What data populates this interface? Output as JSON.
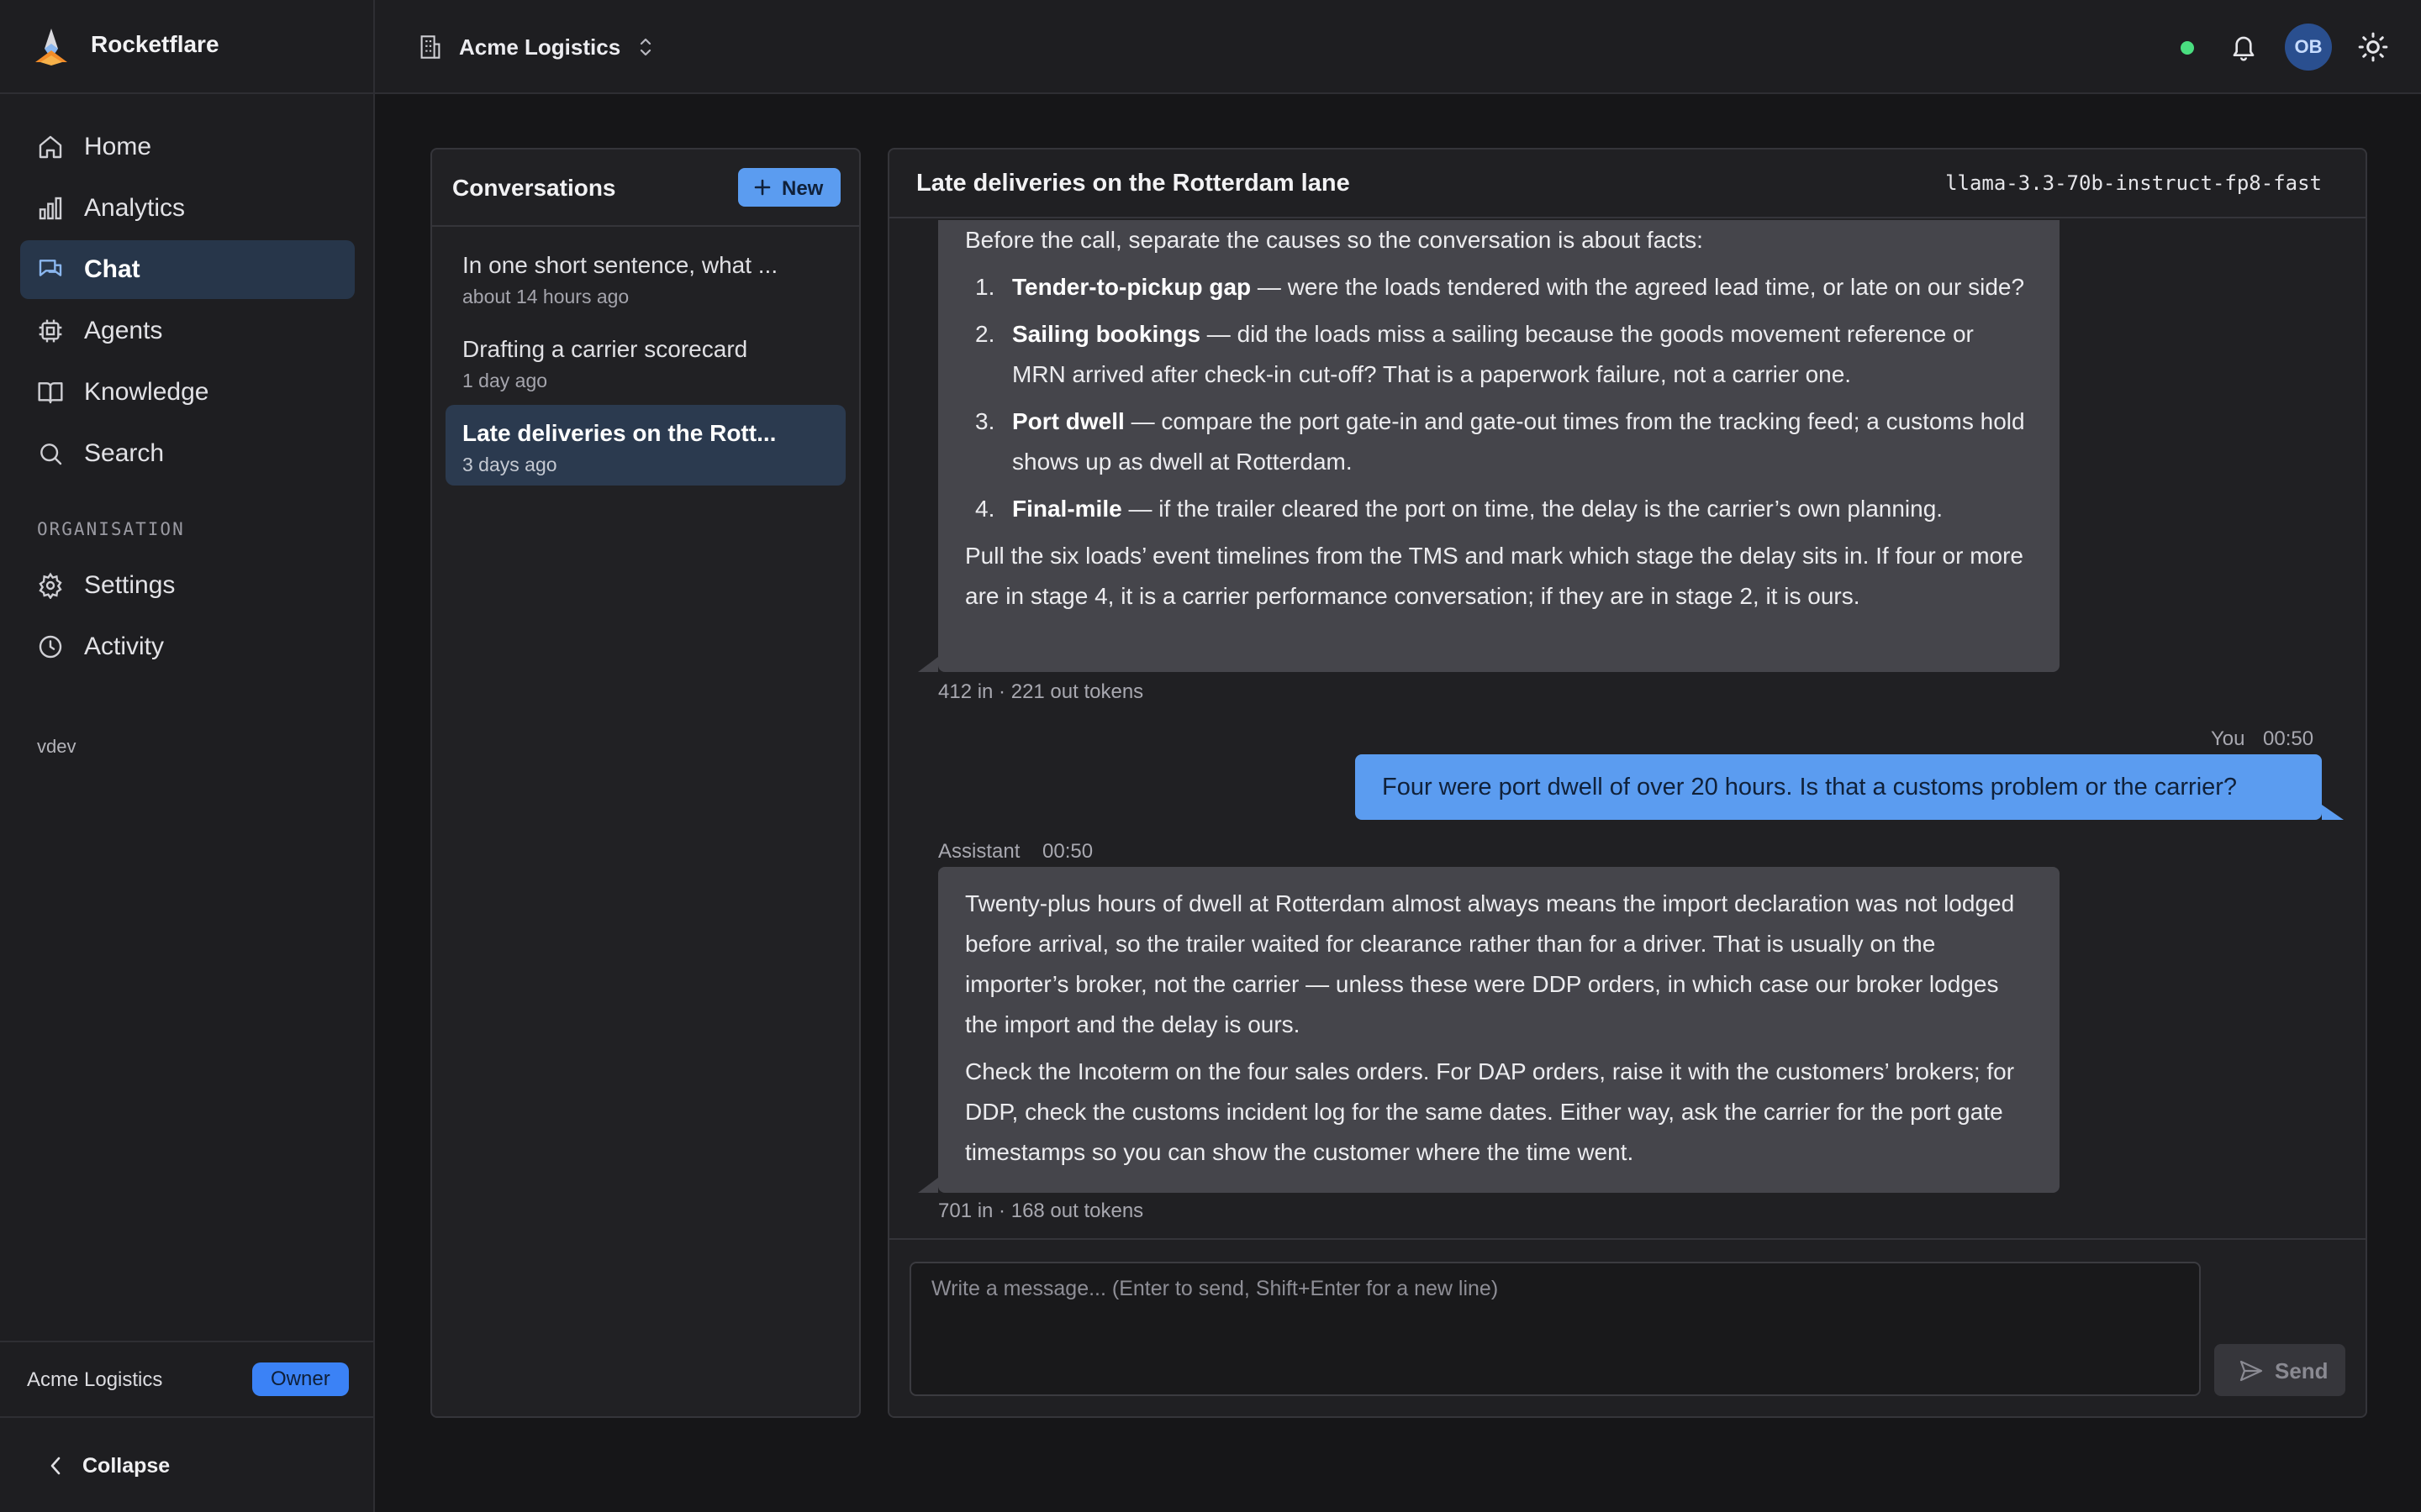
{
  "app": {
    "name": "Rocketflare",
    "version": "vdev"
  },
  "sidebar": {
    "items": [
      {
        "label": "Home",
        "icon": "home-icon"
      },
      {
        "label": "Analytics",
        "icon": "bar-chart-icon"
      },
      {
        "label": "Chat",
        "icon": "chat-icon",
        "active": true
      },
      {
        "label": "Agents",
        "icon": "cpu-icon"
      },
      {
        "label": "Knowledge",
        "icon": "book-icon"
      },
      {
        "label": "Search",
        "icon": "search-icon"
      }
    ],
    "section_label": "ORGANISATION",
    "org_items": [
      {
        "label": "Settings",
        "icon": "gear-icon"
      },
      {
        "label": "Activity",
        "icon": "clock-icon"
      }
    ],
    "footer": {
      "org_name": "Acme Logistics",
      "role_badge": "Owner"
    },
    "collapse_label": "Collapse"
  },
  "topbar": {
    "org_name": "Acme Logistics",
    "avatar_initials": "OB",
    "status_color": "#4ade80"
  },
  "conversations": {
    "title": "Conversations",
    "new_label": "New",
    "items": [
      {
        "title": "In one short sentence, what ...",
        "time": "about 14 hours ago"
      },
      {
        "title": "Drafting a carrier scorecard",
        "time": "1 day ago"
      },
      {
        "title": "Late deliveries on the Rott...",
        "time": "3 days ago",
        "active": true
      }
    ]
  },
  "chat": {
    "title": "Late deliveries on the Rotterdam lane",
    "model": "llama-3.3-70b-instruct-fp8-fast",
    "messages": {
      "first": {
        "intro": "Before the call, separate the causes so the conversation is about facts:",
        "list": [
          {
            "num": "1.",
            "bold": "Tender-to-pickup gap",
            "text": " — were the loads tendered with the agreed lead time, or late on our side?"
          },
          {
            "num": "2.",
            "bold": "Sailing bookings",
            "text": " — did the loads miss a sailing because the goods movement reference or MRN arrived after check-in cut-off? That is a paperwork failure, not a carrier one."
          },
          {
            "num": "3.",
            "bold": "Port dwell",
            "text": " — compare the port gate-in and gate-out times from the tracking feed; a customs hold shows up as dwell at Rotterdam."
          },
          {
            "num": "4.",
            "bold": "Final-mile",
            "text": " — if the trailer cleared the port on time, the delay is the carrier’s own planning."
          }
        ],
        "outro": "Pull the six loads’ event timelines from the TMS and mark which stage the delay sits in. If four or more are in stage 4, it is a carrier performance conversation; if they are in stage 2, it is ours.",
        "tokens": "412 in · 221 out tokens"
      },
      "user": {
        "author": "You",
        "time": "00:50",
        "text": "Four were port dwell of over 20 hours. Is that a customs problem or the carrier?"
      },
      "assistant": {
        "author": "Assistant",
        "time": "00:50",
        "p1": "Twenty-plus hours of dwell at Rotterdam almost always means the import declaration was not lodged before arrival, so the trailer waited for clearance rather than for a driver. That is usually on the importer’s broker, not the carrier — unless these were DDP orders, in which case our broker lodges the import and the delay is ours.",
        "p2": "Check the Incoterm on the four sales orders. For DAP orders, raise it with the customers’ brokers; for DDP, check the customs incident log for the same dates. Either way, ask the carrier for the port gate timestamps so you can show the customer where the time went.",
        "tokens": "701 in · 168 out tokens"
      }
    },
    "composer": {
      "placeholder": "Write a message... (Enter to send, Shift+Enter for a new line)",
      "value": "",
      "send_label": "Send"
    }
  },
  "colors": {
    "accent": "#5b9cf0",
    "background": "#161618",
    "panel": "#202023",
    "assistant_bubble": "#45454b"
  }
}
